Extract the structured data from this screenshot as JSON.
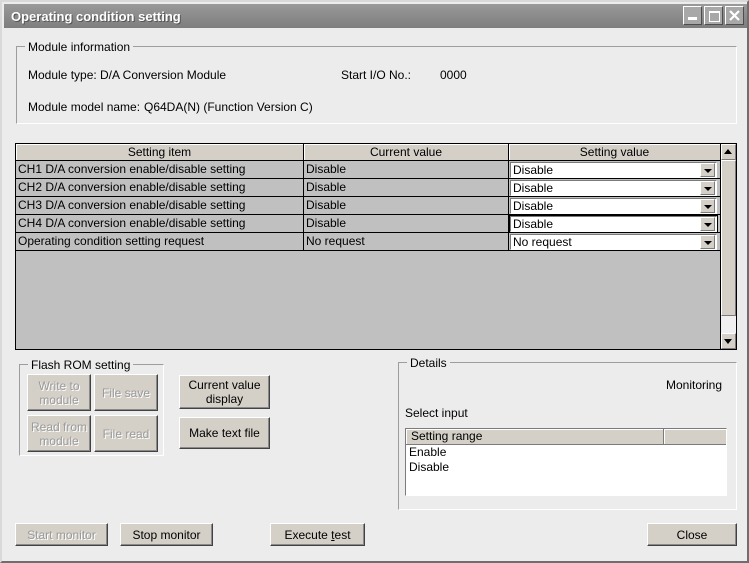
{
  "window": {
    "title": "Operating condition setting",
    "controls": {
      "minimize": "minimize",
      "maximize": "maximize",
      "close": "close"
    }
  },
  "module_information": {
    "legend": "Module information",
    "module_type_label": "Module type:",
    "module_type_value": "D/A Conversion Module",
    "start_io_label": "Start I/O No.:",
    "start_io_value": "0000",
    "model_name_label": "Module model name:",
    "model_name_value": "Q64DA(N) (Function Version C)"
  },
  "settings_table": {
    "columns": [
      "Setting item",
      "Current value",
      "Setting value"
    ],
    "rows": [
      {
        "item": "CH1 D/A conversion enable/disable setting",
        "current": "Disable",
        "setting": "Disable",
        "focused": false
      },
      {
        "item": "CH2 D/A conversion enable/disable setting",
        "current": "Disable",
        "setting": "Disable",
        "focused": false
      },
      {
        "item": "CH3 D/A conversion enable/disable setting",
        "current": "Disable",
        "setting": "Disable",
        "focused": false
      },
      {
        "item": "CH4 D/A conversion enable/disable setting",
        "current": "Disable",
        "setting": "Disable",
        "focused": true
      },
      {
        "item": "Operating condition setting request",
        "current": "No request",
        "setting": "No request",
        "focused": false
      }
    ]
  },
  "flash_rom": {
    "legend": "Flash ROM setting",
    "write_to_module": "Write to\nmodule",
    "file_save": "File save",
    "read_from_module": "Read from\nmodule",
    "file_read": "File read"
  },
  "actions": {
    "current_value_display": "Current value\ndisplay",
    "make_text_file": "Make text file"
  },
  "details": {
    "legend": "Details",
    "monitoring": "Monitoring",
    "select_input": "Select input",
    "list_header": [
      "Setting range",
      ""
    ],
    "list_items": [
      "Enable",
      "Disable"
    ]
  },
  "footer": {
    "start_monitor": "Start monitor",
    "stop_monitor": "Stop monitor",
    "execute_test_pre": "Execute ",
    "execute_test_accel": "t",
    "execute_test_post": "est",
    "close": "Close"
  },
  "colors": {
    "dialog_background": "#ececec",
    "titlebar": "#8e8e8e",
    "table_background": "#c0c0c0",
    "control_face": "#d4d0c8",
    "disabled_text": "#9a9a9a"
  }
}
